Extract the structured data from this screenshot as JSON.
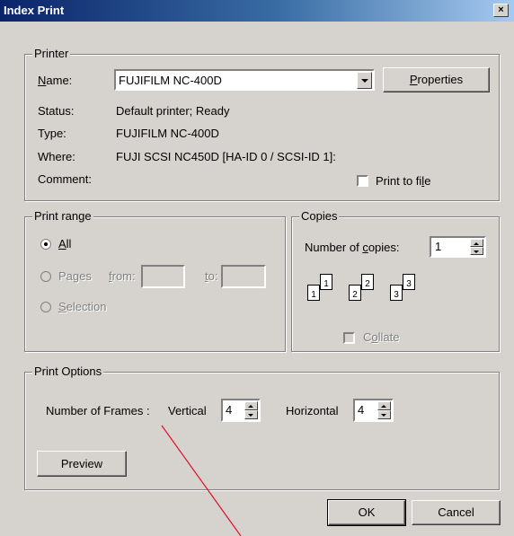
{
  "window": {
    "title": "Index Print",
    "close": "×"
  },
  "printer": {
    "group_label": "Printer",
    "name_label": "Name:",
    "name_value": "FUJIFILM NC-400D",
    "properties_label": "Properties",
    "status_label": "Status:",
    "status_value": "Default printer; Ready",
    "type_label": "Type:",
    "type_value": "FUJIFILM NC-400D",
    "where_label": "Where:",
    "where_value": "FUJI SCSI NC450D [HA-ID 0 / SCSI-ID 1]:",
    "comment_label": "Comment:",
    "print_to_file_label": "Print to file"
  },
  "print_range": {
    "group_label": "Print range",
    "all_label": "All",
    "pages_label": "Pages",
    "from_label": "from:",
    "to_label": "to:",
    "selection_label": "Selection",
    "selected": "All"
  },
  "copies": {
    "group_label": "Copies",
    "number_label": "Number of copies:",
    "number_value": "1",
    "collate_label": "Collate",
    "page_icons": [
      "1",
      "1",
      "2",
      "2",
      "3",
      "3"
    ]
  },
  "print_options": {
    "group_label": "Print Options",
    "frames_label": "Number of Frames :",
    "vertical_label": "Vertical",
    "vertical_value": "4",
    "horizontal_label": "Horizontal",
    "horizontal_value": "4",
    "preview_label": "Preview"
  },
  "buttons": {
    "ok": "OK",
    "cancel": "Cancel"
  },
  "colors": {
    "dialog_bg": "#d6d3ce",
    "title_start": "#0a246a",
    "title_end": "#a6caf0",
    "annotation_line": "#e0102a"
  }
}
